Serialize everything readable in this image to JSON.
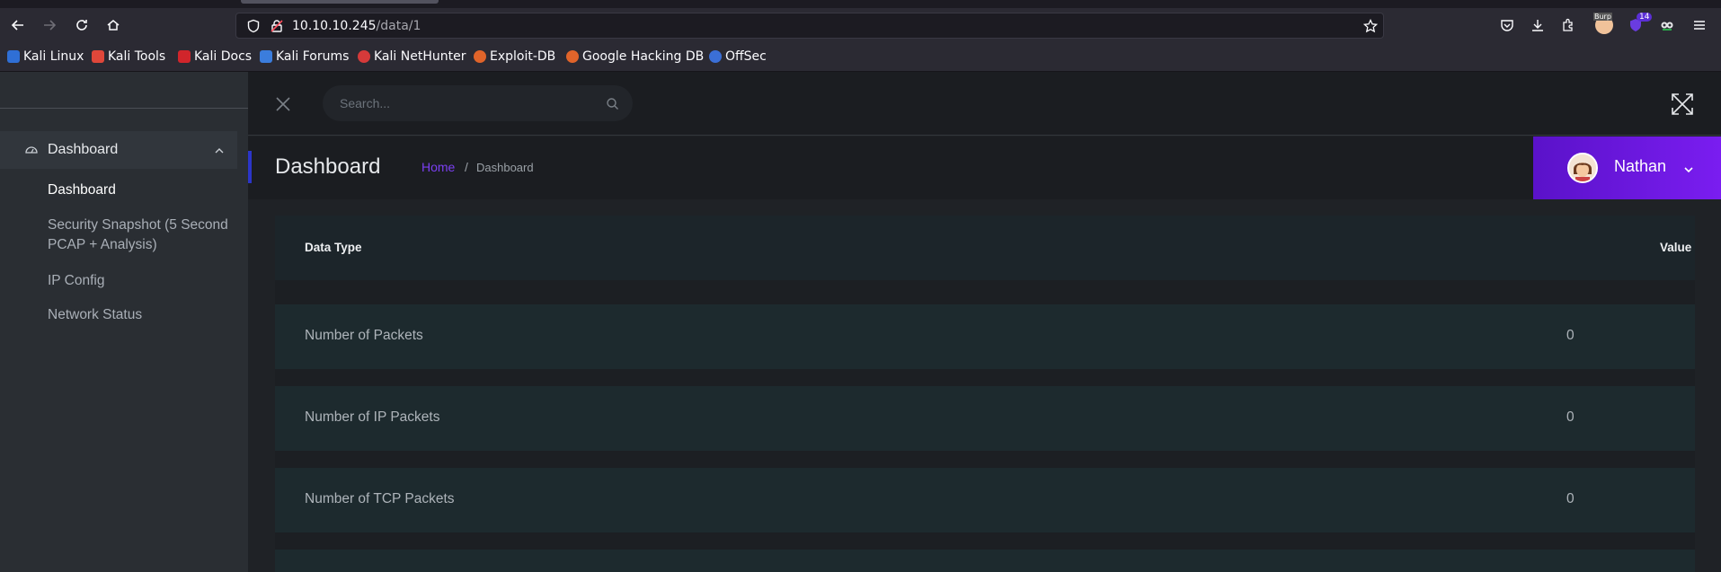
{
  "browser": {
    "url_host": "10.10.10.245",
    "url_path": "/data/1",
    "bookmarks": [
      {
        "label": "Kali Linux",
        "color": "#2f6fd6"
      },
      {
        "label": "Kali Tools",
        "color": "#e0473a"
      },
      {
        "label": "Kali Docs",
        "color": "#d1252b"
      },
      {
        "label": "Kali Forums",
        "color": "#3b7ddd"
      },
      {
        "label": "Kali NetHunter",
        "color": "#d53a3a"
      },
      {
        "label": "Exploit-DB",
        "color": "#e0642a"
      },
      {
        "label": "Google Hacking DB",
        "color": "#e0642a"
      },
      {
        "label": "OffSec",
        "color": "#3b6fd6"
      }
    ],
    "extension_badge": "14",
    "extension_label": "Burp"
  },
  "sidebar": {
    "parent_label": "Dashboard",
    "items": [
      {
        "label": "Dashboard",
        "active": true
      },
      {
        "label": "Security Snapshot (5 Second PCAP + Analysis)",
        "active": false
      },
      {
        "label": "IP Config",
        "active": false
      },
      {
        "label": "Network Status",
        "active": false
      }
    ]
  },
  "topbar": {
    "search_placeholder": "Search..."
  },
  "header": {
    "title": "Dashboard",
    "breadcrumb_home": "Home",
    "breadcrumb_sep": "/",
    "breadcrumb_current": "Dashboard",
    "user_name": "Nathan",
    "accent_color": "#6a17e0",
    "link_color": "#7b3ff2"
  },
  "table": {
    "headers": {
      "key": "Data Type",
      "value": "Value"
    },
    "rows": [
      {
        "key": "Number of Packets",
        "value": "0"
      },
      {
        "key": "Number of IP Packets",
        "value": "0"
      },
      {
        "key": "Number of TCP Packets",
        "value": "0"
      }
    ]
  }
}
